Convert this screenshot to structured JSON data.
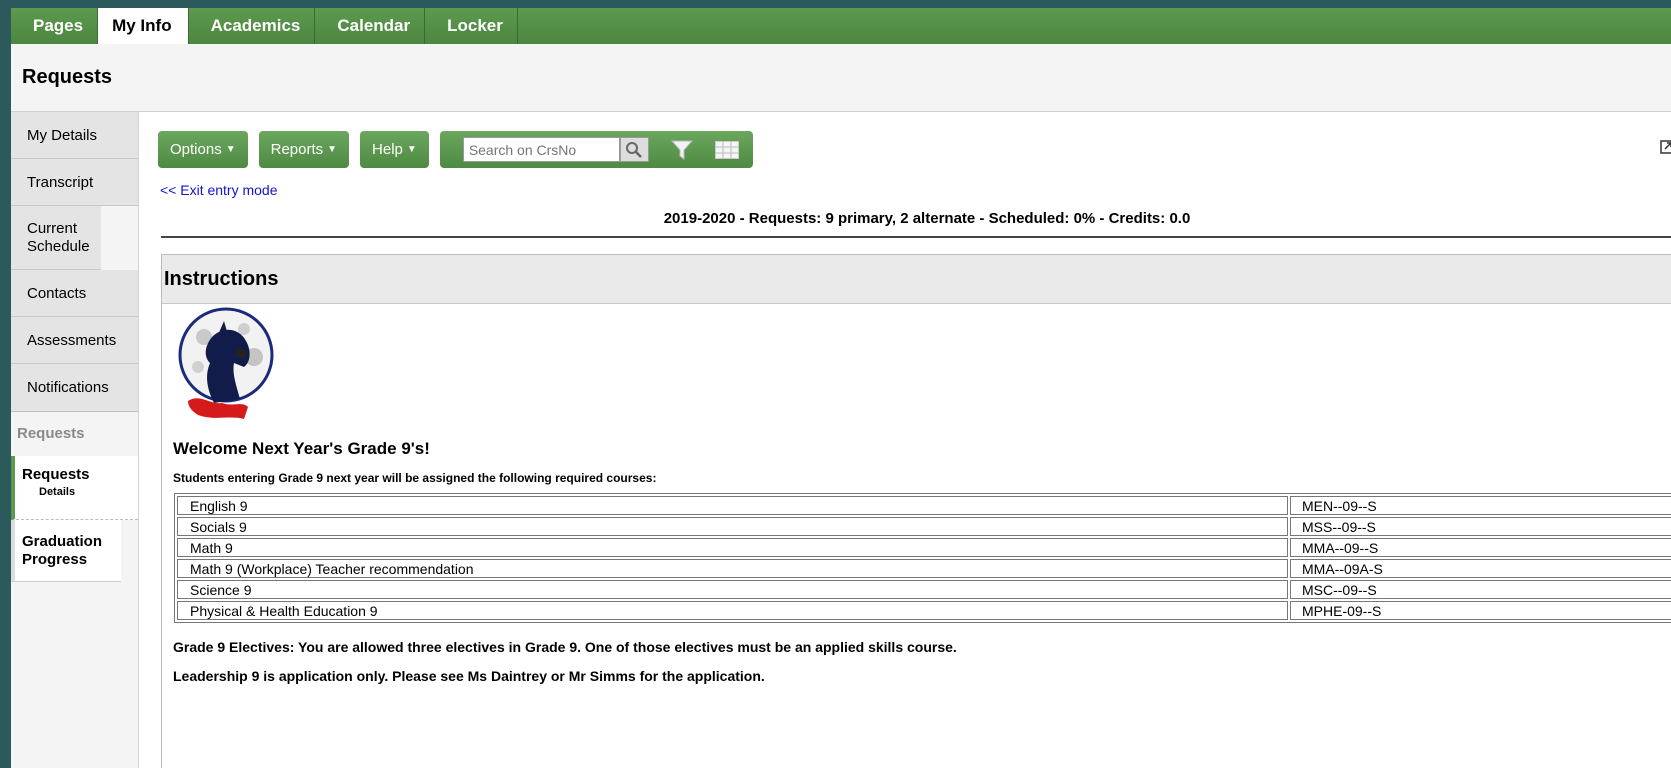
{
  "nav": {
    "tabs": [
      "Pages",
      "My Info",
      "Academics",
      "Calendar",
      "Locker"
    ],
    "active": "My Info"
  },
  "page": {
    "title": "Requests"
  },
  "sidebar": {
    "items": [
      "My Details",
      "Transcript",
      "Current Schedule",
      "Contacts",
      "Assessments",
      "Notifications"
    ],
    "section_label": "Requests",
    "sub_active": {
      "title": "Requests",
      "subtitle": "Details"
    },
    "sub_other": "Graduation Progress"
  },
  "toolbar": {
    "options_label": "Options",
    "reports_label": "Reports",
    "help_label": "Help",
    "search_placeholder": "Search on CrsNo"
  },
  "exit_link": "<< Exit entry mode",
  "summary": "2019-2020 - Requests: 9 primary, 2 alternate - Scheduled: 0% - Credits: 0.0",
  "instructions": {
    "heading": "Instructions",
    "welcome": "Welcome Next Year's Grade 9's!",
    "lead": "Students entering Grade 9 next year will be assigned the following required courses:",
    "courses": [
      {
        "name": "English 9",
        "code": "MEN--09--S"
      },
      {
        "name": "Socials 9",
        "code": "MSS--09--S"
      },
      {
        "name": "Math 9",
        "code": "MMA--09--S"
      },
      {
        "name": "Math 9 (Workplace) Teacher recommendation",
        "code": "MMA--09A-S"
      },
      {
        "name": "Science 9",
        "code": "MSC--09--S"
      },
      {
        "name": "Physical & Health Education 9",
        "code": "MPHE-09--S"
      }
    ],
    "note_electives": "Grade 9 Electives: You are allowed three electives in Grade 9. One of those electives must be an applied skills course.",
    "note_leadership": "Leadership 9 is application only. Please see Ms Daintrey or Mr Simms for the application."
  },
  "colors": {
    "accent": "#5c9a4e",
    "link": "#1414c8",
    "background": "#2c5a5c"
  }
}
